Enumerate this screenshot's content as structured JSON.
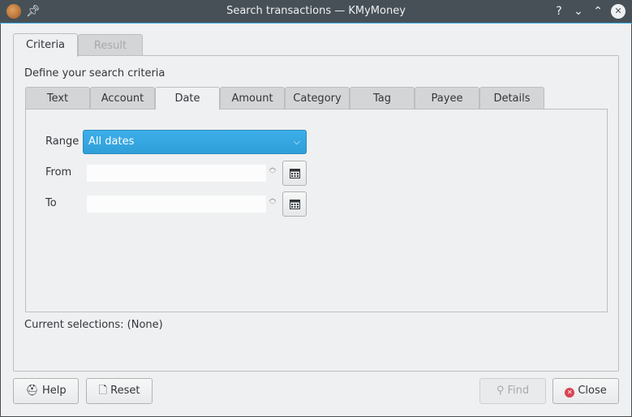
{
  "window": {
    "title": "Search transactions — KMyMoney",
    "controls": {
      "help": "?",
      "minimize": "⌄",
      "maximize": "⌃",
      "close": "✕"
    }
  },
  "outer_tabs": [
    {
      "label": "Criteria",
      "active": true
    },
    {
      "label": "Result",
      "active": false,
      "disabled": true
    }
  ],
  "criteria": {
    "heading": "Define your search criteria",
    "tabs": [
      {
        "label": "Text"
      },
      {
        "label": "Account"
      },
      {
        "label": "Date",
        "active": true
      },
      {
        "label": "Amount"
      },
      {
        "label": "Category"
      },
      {
        "label": "Tag"
      },
      {
        "label": "Payee"
      },
      {
        "label": "Details"
      }
    ],
    "date": {
      "range_label": "Range",
      "range_value": "All dates",
      "from_label": "From",
      "from_value": "",
      "to_label": "To",
      "to_value": ""
    },
    "current_selections": "Current selections: (None)"
  },
  "buttons": {
    "help": "Help",
    "reset": "Reset",
    "find": "Find",
    "close": "Close"
  },
  "colors": {
    "accent": "#3daee9",
    "titlebar": "#475057",
    "close_icon": "#da4453"
  }
}
